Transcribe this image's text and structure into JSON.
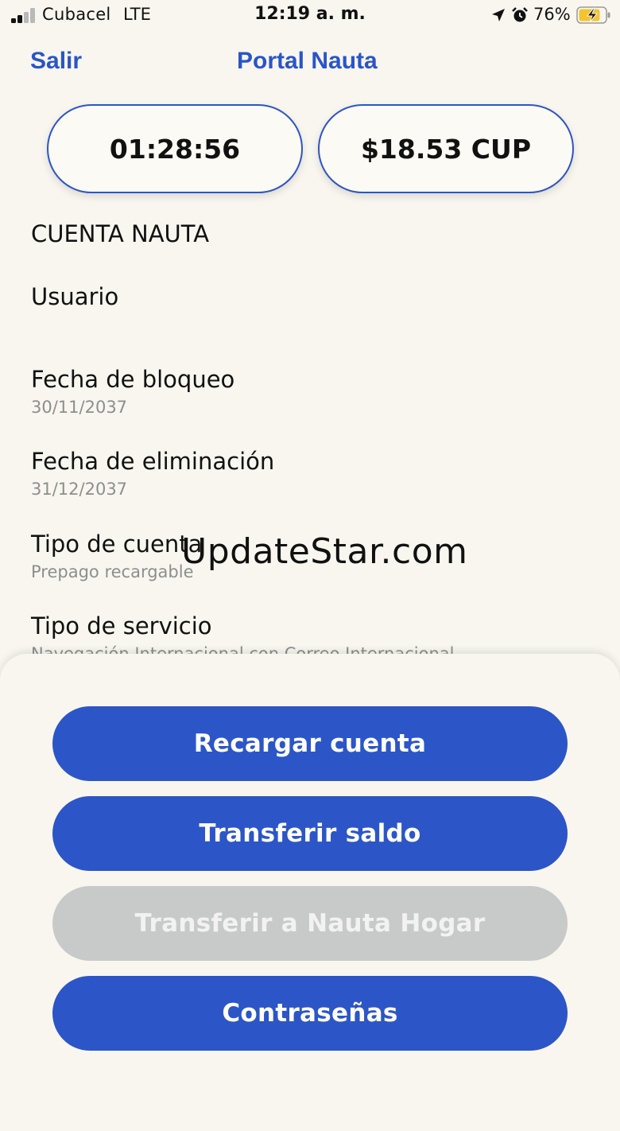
{
  "status_bar": {
    "carrier": "Cubacel",
    "network": "LTE",
    "time": "12:19 a. m.",
    "battery_percent": "76%",
    "icons": [
      "signal-icon",
      "location-arrow-icon",
      "alarm-icon",
      "battery-charging-icon"
    ],
    "battery_level": 0.76
  },
  "nav": {
    "back_label": "Salir",
    "title": "Portal Nauta"
  },
  "summary": {
    "time_remaining": "01:28:56",
    "balance": "$18.53 CUP"
  },
  "account": {
    "section_title": "CUENTA NAUTA",
    "user_label": "Usuario",
    "user_value": "",
    "fields": [
      {
        "label": "Fecha de bloqueo",
        "value": "30/11/2037"
      },
      {
        "label": "Fecha de eliminación",
        "value": "31/12/2037"
      },
      {
        "label": "Tipo de cuenta",
        "value": "Prepago recargable"
      },
      {
        "label": "Tipo de servicio",
        "value": "Navegación Internacional con Correo Internacional"
      }
    ]
  },
  "watermark": "UpdateStar.com",
  "actions": {
    "recharge": "Recargar cuenta",
    "transfer": "Transferir saldo",
    "transfer_home": "Transferir a Nauta Hogar",
    "passwords": "Contraseñas"
  },
  "colors": {
    "accent": "#2c55c7",
    "background": "#f8f6ef",
    "disabled": "#c8c9c9",
    "secondary_text": "#8e8e8e"
  }
}
